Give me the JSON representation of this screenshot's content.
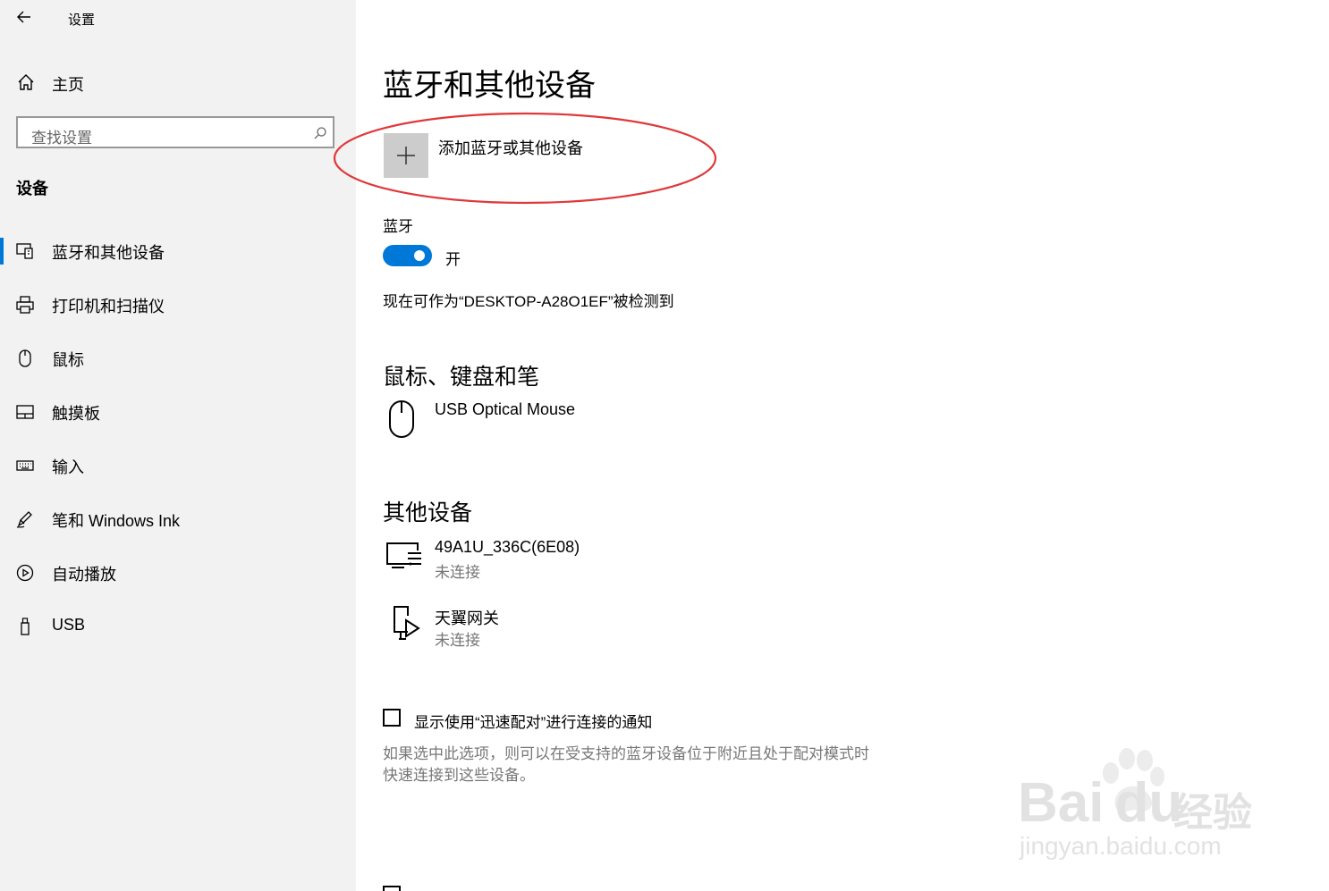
{
  "window": {
    "title": "设置"
  },
  "sidebar": {
    "home_label": "主页",
    "search_placeholder": "查找设置",
    "section_title": "设备",
    "items": [
      {
        "label": "蓝牙和其他设备",
        "icon": "bluetooth-devices-icon",
        "selected": true
      },
      {
        "label": "打印机和扫描仪",
        "icon": "printer-icon"
      },
      {
        "label": "鼠标",
        "icon": "mouse-icon"
      },
      {
        "label": "触摸板",
        "icon": "touchpad-icon"
      },
      {
        "label": "输入",
        "icon": "keyboard-icon"
      },
      {
        "label": "笔和 Windows Ink",
        "icon": "pen-icon"
      },
      {
        "label": "自动播放",
        "icon": "autoplay-icon"
      },
      {
        "label": "USB",
        "icon": "usb-icon"
      }
    ]
  },
  "main": {
    "page_title": "蓝牙和其他设备",
    "add_device_label": "添加蓝牙或其他设备",
    "bluetooth": {
      "label": "蓝牙",
      "toggle_state": "开",
      "toggle_on": true,
      "discoverable_text": "现在可作为“DESKTOP-A28O1EF”被检测到"
    },
    "mouse_section": {
      "title": "鼠标、键盘和笔",
      "devices": [
        {
          "name": "USB Optical Mouse",
          "icon": "mouse-device-icon"
        }
      ]
    },
    "other_section": {
      "title": "其他设备",
      "devices": [
        {
          "name": "49A1U_336C(6E08)",
          "status": "未连接",
          "icon": "display-device-icon"
        },
        {
          "name": "天翼网关",
          "status": "未连接",
          "icon": "media-device-icon"
        }
      ]
    },
    "swift_pair": {
      "label": "显示使用“迅速配对”进行连接的通知",
      "checked": false,
      "description_line1": "如果选中此选项，则可以在受支持的蓝牙设备位于附近且处于配对模式时",
      "description_line2": "快速连接到这些设备。"
    }
  },
  "watermark": {
    "brand": "Bai",
    "brand2": "du",
    "brand_cn": "经验",
    "url": "jingyan.baidu.com"
  },
  "colors": {
    "accent": "#0078d7",
    "sidebar_bg": "#f2f2f2",
    "annotation": "#e0383a",
    "secondary_text": "#777777"
  }
}
